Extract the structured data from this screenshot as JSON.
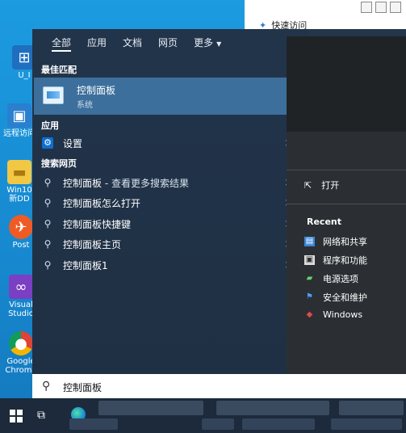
{
  "explorer": {
    "quick_access_label": "快速访问"
  },
  "desktop_icons": [
    {
      "label": "U_I",
      "name": "desktop-icon-u"
    },
    {
      "label": "远程访问",
      "name": "desktop-icon-remote"
    },
    {
      "label": "Win10新DD",
      "name": "desktop-icon-win10"
    },
    {
      "label": "Post",
      "name": "desktop-icon-postman"
    },
    {
      "label": "Visual Studio",
      "name": "desktop-icon-vs"
    },
    {
      "label": "Google Chrome",
      "name": "desktop-icon-chrome"
    }
  ],
  "tabs": [
    {
      "label": "全部",
      "active": true
    },
    {
      "label": "应用",
      "active": false
    },
    {
      "label": "文档",
      "active": false
    },
    {
      "label": "网页",
      "active": false
    },
    {
      "label": "更多",
      "active": false
    }
  ],
  "best_match": {
    "section": "最佳匹配",
    "title": "控制面板",
    "subtitle": "系统"
  },
  "apps": {
    "section": "应用",
    "items": [
      {
        "label": "设置",
        "chevron": ">"
      }
    ]
  },
  "web": {
    "section": "搜索网页",
    "items": [
      {
        "label": "控制面板",
        "suffix": " - 查看更多搜索结果",
        "chevron": ">"
      },
      {
        "label": "控制面板怎么打开",
        "suffix": "",
        "chevron": ">"
      },
      {
        "label": "控制面板快捷键",
        "suffix": "",
        "chevron": ">"
      },
      {
        "label": "控制面板主页",
        "suffix": "",
        "chevron": ">"
      },
      {
        "label": "控制面板1",
        "suffix": "",
        "chevron": ">"
      }
    ]
  },
  "right_pane": {
    "open_label": "打开",
    "recent_title": "Recent",
    "recent_items": [
      {
        "label": "网络和共享",
        "icon": "network-icon"
      },
      {
        "label": "程序和功能",
        "icon": "programs-icon"
      },
      {
        "label": "电源选项",
        "icon": "power-icon"
      },
      {
        "label": "安全和维护",
        "icon": "flag-icon"
      },
      {
        "label": "Windows",
        "icon": "windows-defender-icon"
      }
    ]
  },
  "search": {
    "query": "控制面板"
  }
}
